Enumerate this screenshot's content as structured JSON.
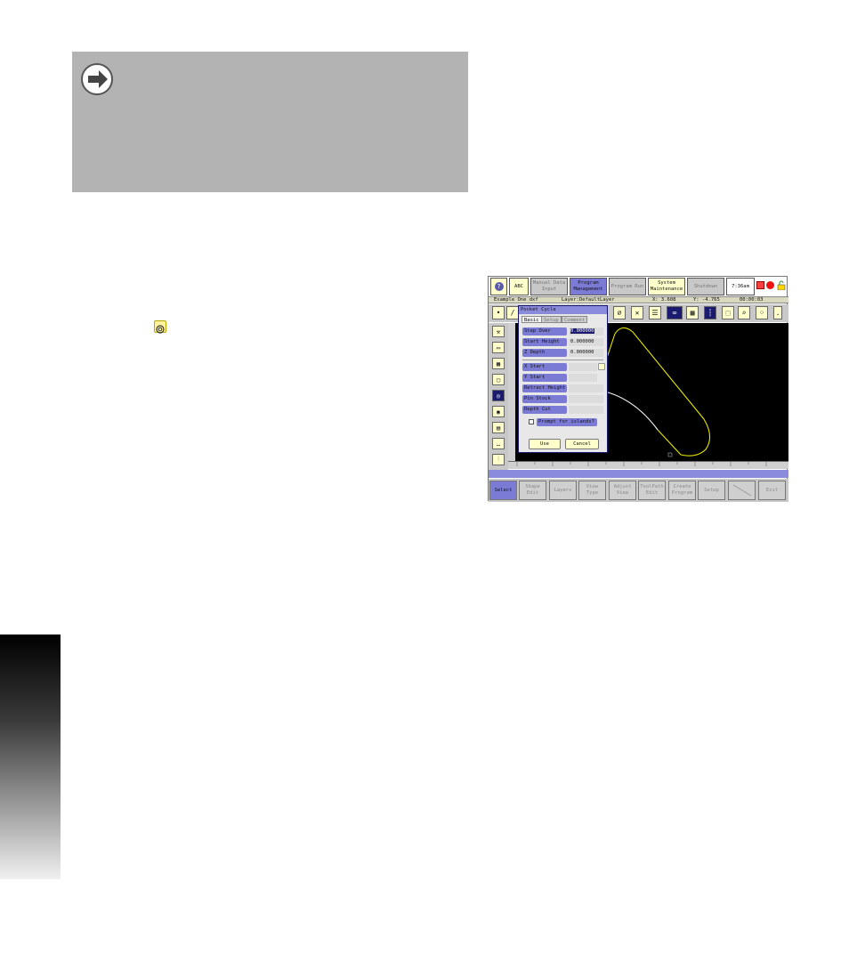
{
  "top_buttons": [
    {
      "label": "ABC",
      "state": "normal"
    },
    {
      "label": "Manual Data Input",
      "state": "dim"
    },
    {
      "label": "Program Management",
      "state": "selected"
    },
    {
      "label": "Program Run",
      "state": "dim"
    },
    {
      "label": "System Maintenance",
      "state": "normal"
    },
    {
      "label": "Shutdown",
      "state": "dim"
    }
  ],
  "clock": "7:36am",
  "status": {
    "file": "Example One dxf",
    "layer": "Layer:DefaultLayer",
    "x": "X: 3.608",
    "y": "Y: -4.765",
    "time": "00:00:03"
  },
  "dialog": {
    "title": "Pocket Cycle",
    "tabs": [
      "Basic",
      "Setup",
      "Comment"
    ],
    "fields": [
      {
        "label": "Step Over",
        "value": "0.000000"
      },
      {
        "label": "Start Height",
        "value": "0.000000"
      },
      {
        "label": "Z Depth",
        "value": "0.000000"
      },
      {
        "label": "X Start",
        "value": ""
      },
      {
        "label": "Y Start",
        "value": ""
      },
      {
        "label": "Retract Height",
        "value": ""
      },
      {
        "label": "Pin Stock",
        "value": ""
      },
      {
        "label": "Depth Cut",
        "value": ""
      }
    ],
    "checkbox_label": "Prompt for islands?",
    "use_label": "Use",
    "cancel_label": "Cancel"
  },
  "bottom_buttons": [
    {
      "label": "Select",
      "state": "selected"
    },
    {
      "label": "Shape Edit",
      "state": "dim"
    },
    {
      "label": "Layers",
      "state": "dim"
    },
    {
      "label": "View Type",
      "state": "dim"
    },
    {
      "label": "Adjust View",
      "state": "dim"
    },
    {
      "label": "ToolPath Edit",
      "state": "dim"
    },
    {
      "label": "Create Program",
      "state": "dim"
    },
    {
      "label": "Setup",
      "state": "dim"
    },
    {
      "label": "",
      "state": "dim"
    },
    {
      "label": "Exit",
      "state": "dim"
    }
  ],
  "colors": {
    "accent": "#7b7bd6",
    "highlight": "#ffffcc",
    "shape": "#e6e600"
  }
}
